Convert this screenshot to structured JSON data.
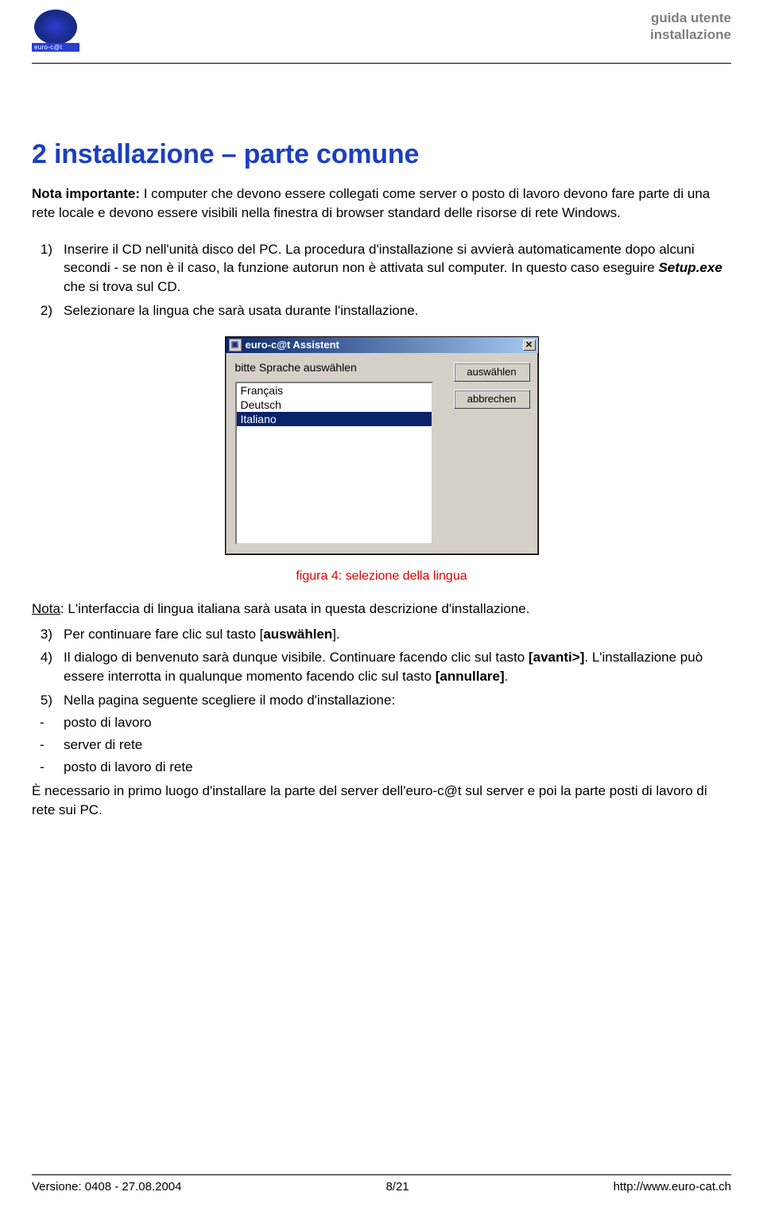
{
  "header": {
    "logo_text": "euro-c@t",
    "right_line1": "guida utente",
    "right_line2": "installazione"
  },
  "title": "2  installazione – parte comune",
  "note": {
    "label": "Nota importante:",
    "text": " I computer che devono essere collegati come server o posto di lavoro devono fare parte di una rete locale e devono essere visibili nella finestra di browser standard delle risorse di rete Windows."
  },
  "list": {
    "item1_num": "1)",
    "item1_a": "Inserire il CD nell'unità disco del PC. La procedura d'installazione si avvierà automaticamente dopo alcuni secondi - se non è il caso, la funzione autorun non è attivata sul computer. In questo caso eseguire ",
    "item1_setup": "Setup.exe",
    "item1_b": " che si trova sul CD.",
    "item2_num": "2)",
    "item2": "Selezionare la lingua che sarà usata durante l'installazione."
  },
  "dialog": {
    "title": "euro-c@t Assistent",
    "prompt": "bitte Sprache auswählen",
    "options": [
      "Français",
      "Deutsch",
      "Italiano"
    ],
    "selected_index": 2,
    "btn_ok": "auswählen",
    "btn_cancel": "abbrechen"
  },
  "caption": "figura 4: selezione della lingua",
  "after": {
    "nota_u": "Nota",
    "nota_rest": ": L'interfaccia di lingua italiana sarà usata in questa descrizione d'installazione.",
    "item3_num": "3)",
    "item3_a": "Per continuare fare clic sul tasto [",
    "item3_bold": "auswählen",
    "item3_b": "].",
    "item4_num": "4)",
    "item4_a": "Il dialogo di benvenuto sarà dunque visibile. Continuare facendo clic sul tasto ",
    "item4_bold1": "[avanti>]",
    "item4_b": ". L'installazione può essere interrotta in qualunque momento facendo clic sul tasto ",
    "item4_bold2": "[annullare]",
    "item4_c": ".",
    "item5_num": "5)",
    "item5": "Nella pagina seguente scegliere il modo d'installazione:",
    "dash1": "posto di lavoro",
    "dash2": "server di rete",
    "dash3": "posto di lavoro di rete",
    "final": "È necessario in primo luogo d'installare la parte del server dell'euro-c@t sul server e poi la parte posti di lavoro di rete sui PC."
  },
  "footer": {
    "version": "Versione: 0408 - 27.08.2004",
    "page": "8/21",
    "url": "http://www.euro-cat.ch"
  }
}
